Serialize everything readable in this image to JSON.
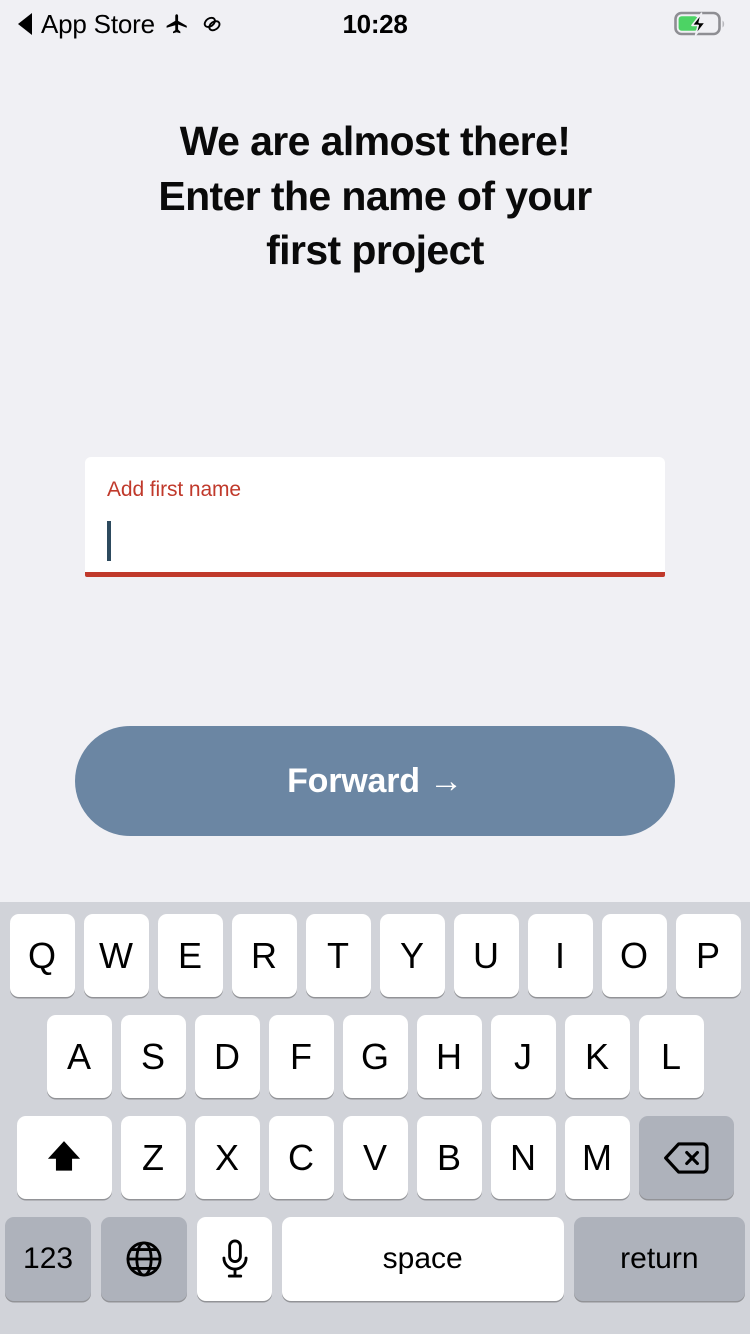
{
  "status_bar": {
    "back_label": "App Store",
    "back_icon": "back-triangle-icon",
    "airplane_icon": "airplane-mode-icon",
    "link_icon": "link-icon",
    "time": "10:28",
    "battery_icon": "battery-charging-icon",
    "battery_level_percent": 45
  },
  "main": {
    "title": "We are almost there!\nEnter the name of your first project",
    "title_line1": "We are almost there!",
    "title_line2": "Enter the name of your",
    "title_line3": "first project",
    "name_field": {
      "label": "Add first name",
      "value": "",
      "placeholder": "",
      "error": true,
      "focused": true
    },
    "forward_button": {
      "label": "Forward →"
    }
  },
  "colors": {
    "page_background": "#f0f0f4",
    "error_red": "#c0392b",
    "button_blue": "#6b86a3",
    "caret_blue": "#2d4a5e",
    "keyboard_background": "#d1d3d9",
    "key_white": "#ffffff",
    "key_gray": "#aeb2bb",
    "battery_green": "#4cd364"
  },
  "keyboard": {
    "layout": "qwerty-uppercase",
    "row1": [
      "Q",
      "W",
      "E",
      "R",
      "T",
      "Y",
      "U",
      "I",
      "O",
      "P"
    ],
    "row2": [
      "A",
      "S",
      "D",
      "F",
      "G",
      "H",
      "J",
      "K",
      "L"
    ],
    "row3_letters": [
      "Z",
      "X",
      "C",
      "V",
      "B",
      "N",
      "M"
    ],
    "shift_icon": "shift-arrow-icon",
    "backspace_icon": "backspace-delete-icon",
    "row4": {
      "numbers_label": "123",
      "globe_icon": "globe-icon",
      "mic_icon": "microphone-icon",
      "space_label": "space",
      "return_label": "return"
    }
  }
}
